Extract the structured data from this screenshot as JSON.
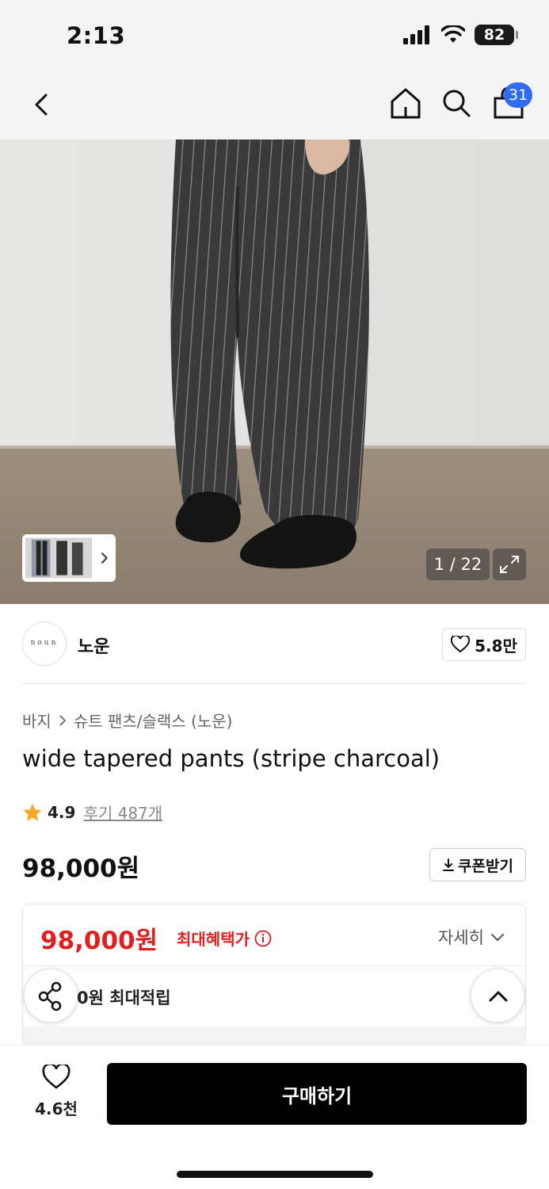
{
  "status_bar": {
    "time": "2:13",
    "battery": "82"
  },
  "nav": {
    "cart_count": "31"
  },
  "gallery": {
    "counter": "1 / 22"
  },
  "brand": {
    "logo_text": "noun",
    "name": "노운",
    "likes": "5.8만"
  },
  "product": {
    "breadcrumb": [
      "바지",
      "슈트 팬츠/슬랙스 (노운)"
    ],
    "title": "wide tapered pants (stripe charcoal)",
    "rating": "4.9",
    "reviews": "후기 487개",
    "price": "98,000원",
    "coupon_label": "쿠폰받기"
  },
  "benefit": {
    "max_price": "98,000원",
    "max_label": "최대혜택가",
    "detail_label": "자세히",
    "points_text": "0원 최대적립"
  },
  "bottom": {
    "wish_count": "4.6천",
    "buy_label": "구매하기"
  },
  "colors": {
    "accent_blue": "#2f6bf5",
    "sale_red": "#e02020",
    "star": "#f5a623"
  }
}
